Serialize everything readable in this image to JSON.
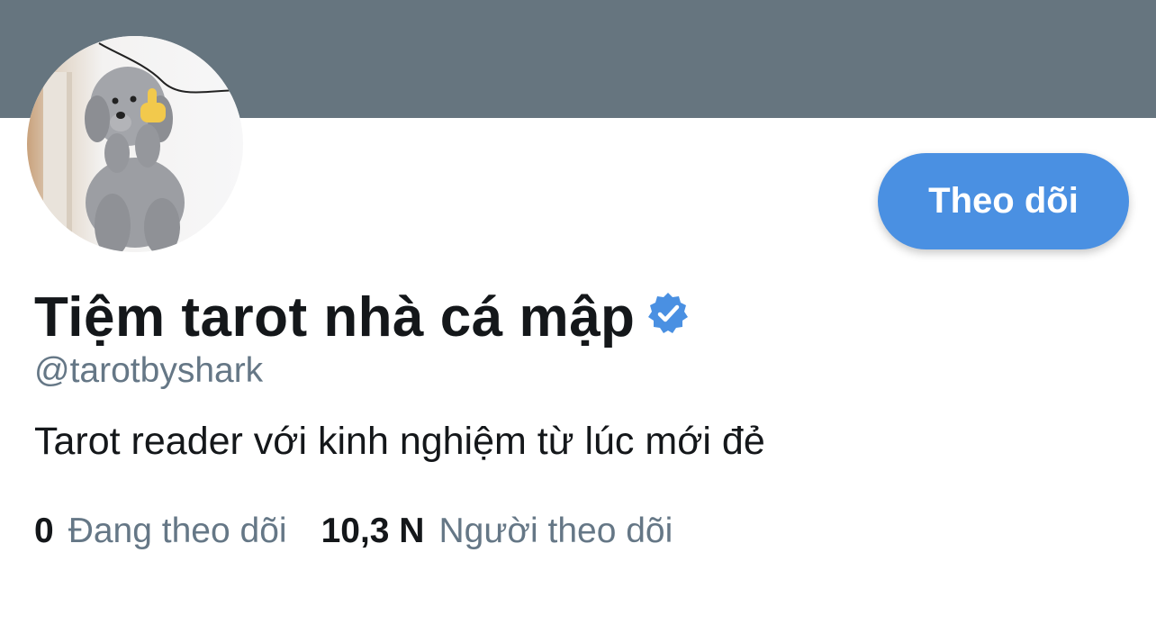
{
  "profile": {
    "display_name": "Tiệm tarot nhà cá mập",
    "handle": "@tarotbyshark",
    "bio": "Tarot reader với kinh nghiệm từ lúc mới đẻ",
    "verified": true,
    "avatar_icon": "poodle-avatar-photo"
  },
  "actions": {
    "follow_label": "Theo dõi"
  },
  "stats": {
    "following_count": "0",
    "following_label": "Đang theo dõi",
    "followers_count": "10,3 N",
    "followers_label": "Người theo dõi"
  },
  "colors": {
    "banner": "#66757f",
    "accent": "#4a90e2",
    "text_primary": "#14171a",
    "text_secondary": "#657786"
  }
}
